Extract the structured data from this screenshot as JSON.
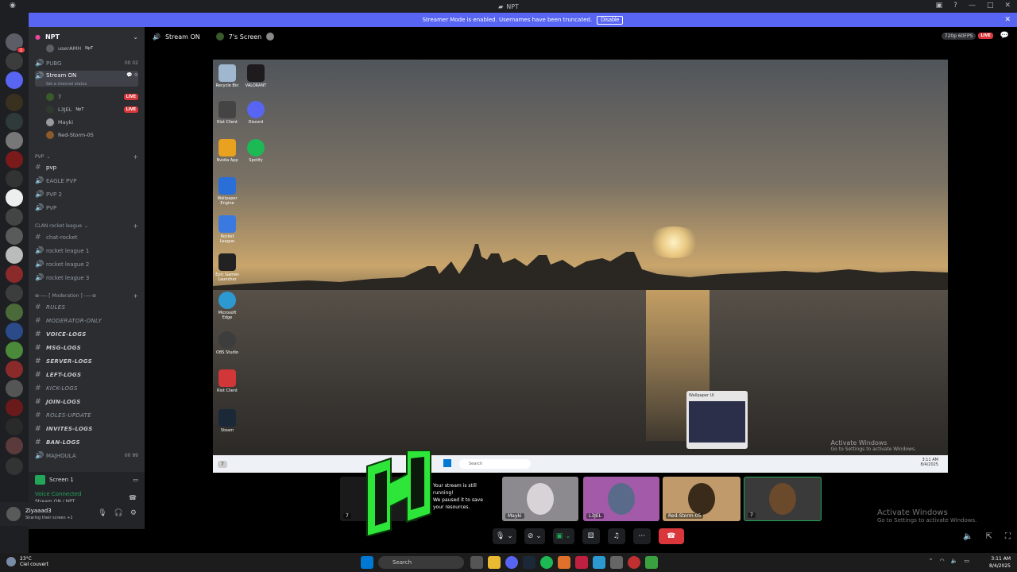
{
  "window": {
    "title": "NPT"
  },
  "banner": {
    "text": "Streamer Mode is enabled. Usernames have been truncated.",
    "disable_label": "Disable"
  },
  "server": {
    "name": "NPT"
  },
  "server_rail_badges": [
    "1",
    "",
    "",
    "",
    "",
    "",
    "",
    "",
    "",
    "",
    "",
    "",
    "",
    "",
    "",
    "",
    "",
    "",
    "",
    "",
    "",
    "",
    "",
    ""
  ],
  "channels": {
    "top_user": "userAMH",
    "top_user_tag": "NpT",
    "pubg": {
      "label": "PUBG",
      "count": "00 02"
    },
    "stream_on": {
      "label": "Stream ON",
      "status": "Set a channel status"
    },
    "voice_users": [
      {
        "name": "7",
        "live": "LIVE"
      },
      {
        "name": "L3JEL",
        "tag": "NpT",
        "live": "LIVE"
      },
      {
        "name": "Mayki"
      },
      {
        "name": "Red-Storm-05"
      }
    ],
    "pvp_category": "PVP",
    "pvp_channels": [
      "pvp",
      "EAGLE PVP",
      "PVP 2",
      "PVP"
    ],
    "clan_category": "CLAN rocket league",
    "clan_channels": [
      "chat-rocket",
      "rocket league 1",
      "rocket league 2",
      "rocket league 3"
    ],
    "moderation_category": "⊕-—- [ Moderation ] -—-⊕",
    "mod_channels": [
      "RULES",
      "MODERATOR-ONLY",
      "VOICE-LOGS",
      "MSG-LOGS",
      "SERVER-LOGS",
      "LEFT-LOGS",
      "KICK-LOGS",
      "JOIN-LOGS",
      "ROLES-UPDATE",
      "INVITES-LOGS",
      "BAN-LOGS"
    ],
    "majhoula": {
      "label": "MAJHOULA",
      "count": "00 99"
    }
  },
  "voice_panel": {
    "screen_label": "Screen 1",
    "connected": "Voice Connected",
    "channel": "Stream ON / NPT"
  },
  "user": {
    "name": "Ziyaaad3",
    "status": "Sharing their screen +1"
  },
  "stage": {
    "channel": "Stream ON",
    "screen_owner": "7's Screen",
    "quality": "720p 60FPS",
    "live": "LIVE"
  },
  "desktop_icons": [
    "Recycle Bin",
    "VALORANT",
    "Riot Client",
    "Discord",
    "Nvidia App",
    "Spotify",
    "Wallpaper Engine",
    "Rocket League",
    "Epic Games Launcher",
    "Microsoft Edge",
    "OBS Studio",
    "Riot Client",
    "Steam"
  ],
  "desktop": {
    "activate_title": "Activate Windows",
    "activate_sub": "Go to Settings to activate Windows.",
    "popup_title": "Wallpaper UI",
    "search": "Search",
    "time": "3:11 AM",
    "date": "8/4/2025",
    "taskbar_tab": "7"
  },
  "participants": [
    {
      "name": "7"
    },
    {
      "name": "Mayki"
    },
    {
      "name": "L3JEL"
    },
    {
      "name": "Red-Storm-05"
    },
    {
      "name": "7"
    }
  ],
  "toast": {
    "line1": "Your stream is still",
    "line2": "running!",
    "line3": "We paused it to save",
    "line4": "your resources."
  },
  "overlay_activate": {
    "title": "Activate Windows",
    "sub": "Go to Settings to activate Windows."
  },
  "taskbar": {
    "weather_temp": "23°C",
    "weather_desc": "Ciel couvert",
    "search": "Search",
    "time": "3:11 AM",
    "date": "8/4/2025"
  }
}
